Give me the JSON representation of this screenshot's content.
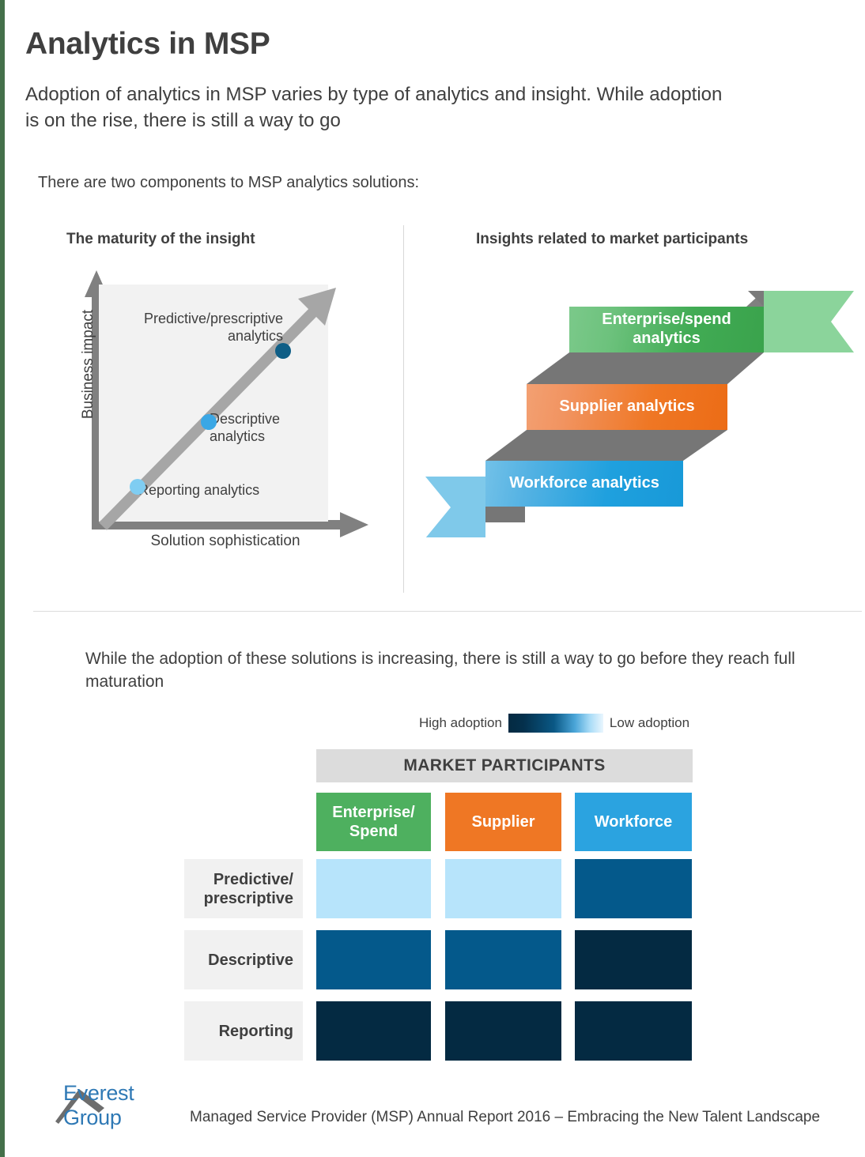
{
  "accent_colors": {
    "edge_strip": "#44704a",
    "green": "#4eb05f",
    "orange": "#ef7724",
    "blue": "#2ba3e0",
    "logo_blue": "#2f79b5",
    "panel_bg": "#f2f2f2",
    "header_gray": "#dcdcdc"
  },
  "header": {
    "title": "Analytics in MSP",
    "subtitle": "Adoption of analytics in MSP varies by type of analytics and insight. While adoption is on the rise, there is still a way to go"
  },
  "intro": {
    "line": "There are two components to MSP analytics solutions:"
  },
  "left_panel": {
    "title": "The maturity of the insight"
  },
  "right_panel": {
    "title": "Insights related to market participants",
    "ribbons": [
      {
        "label": "Enterprise/spend analytics",
        "color": "#41ab54"
      },
      {
        "label": "Supplier analytics",
        "color": "#ef7724"
      },
      {
        "label": "Workforce analytics",
        "color": "#1fa0de"
      }
    ]
  },
  "lower": {
    "note": "While the adoption of these solutions is increasing, there is still a way to go before they reach full maturation",
    "legend": {
      "high": "High adoption",
      "low": "Low adoption"
    },
    "matrix_header": "MARKET PARTICIPANTS"
  },
  "footer": {
    "logo_text": "Everest Group",
    "text": "Managed Service Provider (MSP) Annual Report 2016 – Embracing the New Talent Landscape"
  },
  "chart_data": [
    {
      "type": "scatter",
      "title": "The maturity of the insight",
      "xlabel": "Solution sophistication",
      "ylabel": "Business impact",
      "grid": false,
      "legend": "none",
      "xlim": [
        0,
        10
      ],
      "ylim": [
        0,
        10
      ],
      "points": [
        {
          "label": "Reporting analytics",
          "x": 1.7,
          "y": 1.7,
          "color": "#7fcdf2"
        },
        {
          "label": "Descriptive analytics",
          "x": 4.8,
          "y": 4.8,
          "color": "#3aa7e5"
        },
        {
          "label": "Predictive/prescriptive analytics",
          "x": 8.0,
          "y": 8.0,
          "color": "#0f5e86"
        }
      ],
      "annotations": [
        "Trend arrow rising from origin to upper-right"
      ]
    },
    {
      "type": "heatmap",
      "title": "MARKET PARTICIPANTS",
      "xlabel": "",
      "ylabel": "",
      "legend": "High adoption (dark) to Low adoption (light)",
      "categories": [
        "Enterprise/\nSpend",
        "Supplier",
        "Workforce"
      ],
      "rows": [
        "Predictive/\nprescriptive",
        "Descriptive",
        "Reporting"
      ],
      "column_colors": [
        "#4eb05f",
        "#ef7724",
        "#2ba3e0"
      ],
      "values": [
        [
          1,
          1,
          3
        ],
        [
          3,
          3,
          4
        ],
        [
          4,
          4,
          4
        ]
      ],
      "value_scale": {
        "1": "#b7e4fb",
        "2": "#4aa5d8",
        "3": "#04598b",
        "4": "#042a42"
      },
      "cells": [
        [
          "#b7e4fb",
          "#b7e4fb",
          "#04598b"
        ],
        [
          "#04598b",
          "#04598b",
          "#042a42"
        ],
        [
          "#042a42",
          "#042a42",
          "#042a42"
        ]
      ]
    }
  ]
}
